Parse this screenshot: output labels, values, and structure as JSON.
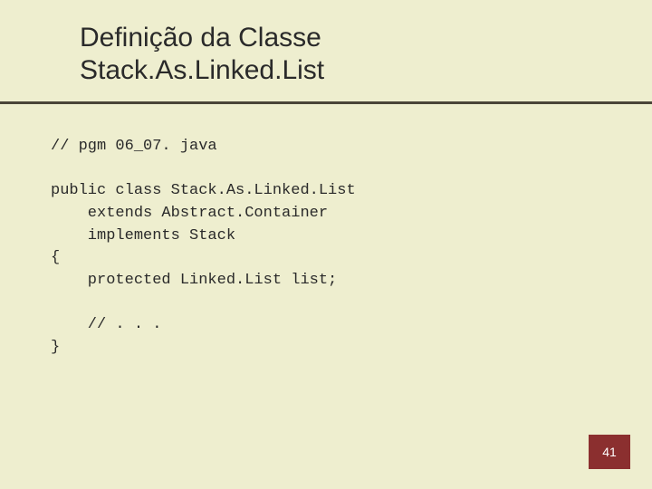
{
  "title": {
    "line1": "Definição da Classe",
    "line2": "Stack.As.Linked.List"
  },
  "code": {
    "l1": "// pgm 06_07. java",
    "l2": "",
    "l3": "public class Stack.As.Linked.List",
    "l4": "    extends Abstract.Container",
    "l5": "    implements Stack",
    "l6": "{",
    "l7": "    protected Linked.List list;",
    "l8": "",
    "l9": "    // . . .",
    "l10": "}"
  },
  "page_number": "41"
}
